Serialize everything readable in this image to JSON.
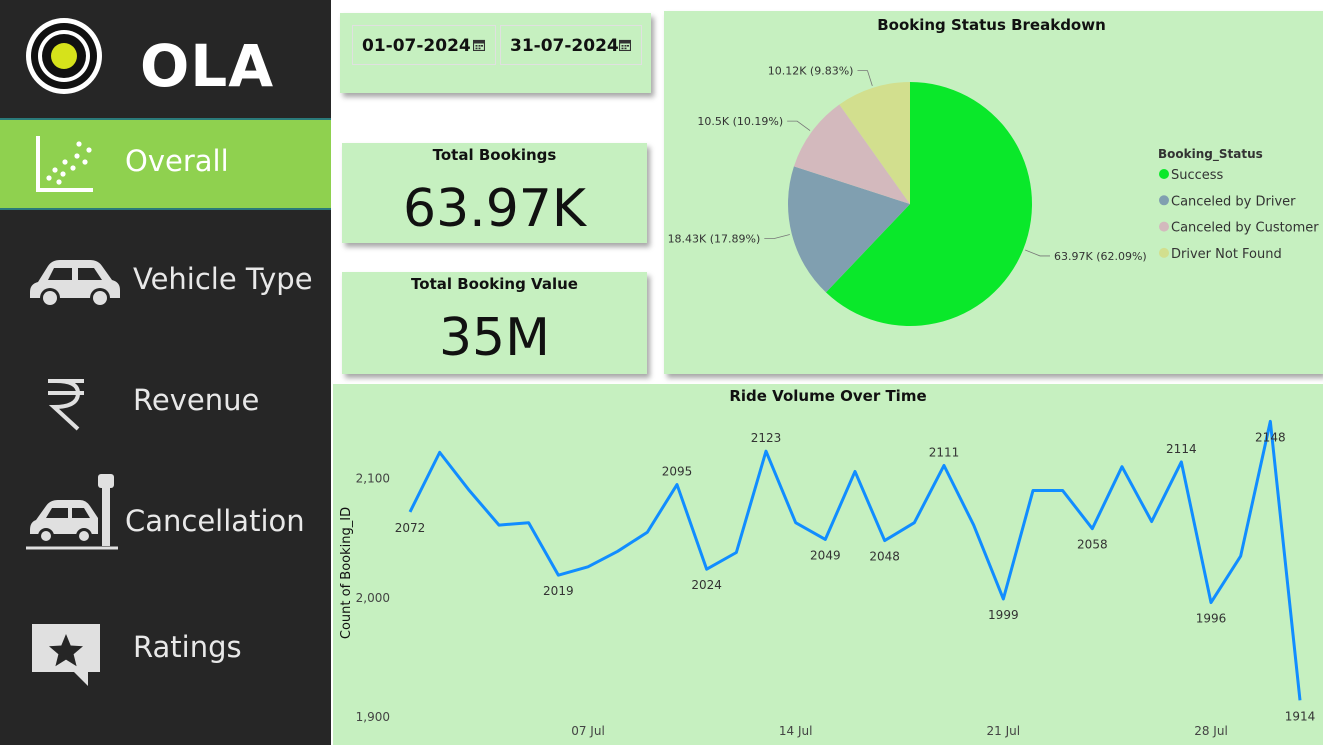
{
  "brand": {
    "name": "OLA"
  },
  "sidebar": {
    "items": [
      {
        "label": "Overall",
        "icon": "scatter-chart-icon",
        "active": true
      },
      {
        "label": "Vehicle Type",
        "icon": "car-icon",
        "active": false
      },
      {
        "label": "Revenue",
        "icon": "rupee-icon",
        "active": false
      },
      {
        "label": "Cancellation",
        "icon": "car-crash-icon",
        "active": false
      },
      {
        "label": "Ratings",
        "icon": "star-comment-icon",
        "active": false
      }
    ]
  },
  "filters": {
    "start_date": "01-07-2024",
    "end_date": "31-07-2024"
  },
  "kpis": {
    "total_bookings": {
      "title": "Total Bookings",
      "value": "63.97K"
    },
    "total_booking_value": {
      "title": "Total Booking Value",
      "value": "35M"
    }
  },
  "colors": {
    "sidebar_bg": "#262626",
    "active_nav": "#8fd14f",
    "card_bg": "#c6f0c0",
    "line": "#118DFF",
    "success": "#0ae82a",
    "canceled_driver": "#809fb0",
    "canceled_customer": "#d3b9bd",
    "driver_not_found": "#d2df8e"
  },
  "pie_chart": {
    "chart_data": {
      "type": "pie",
      "title": "Booking Status Breakdown",
      "legend_title": "Booking_Status",
      "legend_position": "right",
      "slices": [
        {
          "name": "Success",
          "value": 63970,
          "label": "63.97K (62.09%)",
          "color": "#0ae82a"
        },
        {
          "name": "Canceled by Driver",
          "value": 18430,
          "label": "18.43K (17.89%)",
          "color": "#809fb0"
        },
        {
          "name": "Canceled by Customer",
          "value": 10500,
          "label": "10.5K (10.19%)",
          "color": "#d3b9bd"
        },
        {
          "name": "Driver Not Found",
          "value": 10120,
          "label": "10.12K (9.83%)",
          "color": "#d2df8e"
        }
      ]
    }
  },
  "line_chart": {
    "chart_data": {
      "type": "line",
      "title": "Ride Volume Over Time",
      "ylabel": "Count of Booking_ID",
      "xlabel": "",
      "ylim": [
        1900,
        2150
      ],
      "y_ticks": [
        "1,900",
        "2,000",
        "2,100"
      ],
      "x_ticks": [
        "07 Jul",
        "14 Jul",
        "21 Jul",
        "28 Jul"
      ],
      "grid": false,
      "x": [
        "2024-07-01",
        "2024-07-02",
        "2024-07-03",
        "2024-07-04",
        "2024-07-05",
        "2024-07-06",
        "2024-07-07",
        "2024-07-08",
        "2024-07-09",
        "2024-07-10",
        "2024-07-11",
        "2024-07-12",
        "2024-07-13",
        "2024-07-14",
        "2024-07-15",
        "2024-07-16",
        "2024-07-17",
        "2024-07-18",
        "2024-07-19",
        "2024-07-20",
        "2024-07-21",
        "2024-07-22",
        "2024-07-23",
        "2024-07-24",
        "2024-07-25",
        "2024-07-26",
        "2024-07-27",
        "2024-07-28",
        "2024-07-29",
        "2024-07-30",
        "2024-07-31"
      ],
      "series": [
        {
          "values": [
            2072,
            2122,
            2090,
            2061,
            2063,
            2019,
            2026,
            2039,
            2055,
            2095,
            2024,
            2038,
            2123,
            2063,
            2049,
            2106,
            2048,
            2063,
            2111,
            2061,
            1999,
            2090,
            2090,
            2058,
            2110,
            2064,
            2114,
            1996,
            2035,
            2148,
            1914
          ]
        }
      ],
      "data_labels": [
        {
          "index": 0,
          "text": "2072",
          "pos": "below"
        },
        {
          "index": 5,
          "text": "2019",
          "pos": "below"
        },
        {
          "index": 9,
          "text": "2095",
          "pos": "above"
        },
        {
          "index": 10,
          "text": "2024",
          "pos": "below"
        },
        {
          "index": 12,
          "text": "2123",
          "pos": "above"
        },
        {
          "index": 14,
          "text": "2049",
          "pos": "below"
        },
        {
          "index": 16,
          "text": "2048",
          "pos": "below"
        },
        {
          "index": 18,
          "text": "2111",
          "pos": "above"
        },
        {
          "index": 20,
          "text": "1999",
          "pos": "below"
        },
        {
          "index": 23,
          "text": "2058",
          "pos": "below"
        },
        {
          "index": 26,
          "text": "2114",
          "pos": "above"
        },
        {
          "index": 27,
          "text": "1996",
          "pos": "below"
        },
        {
          "index": 29,
          "text": "2148",
          "pos": "below"
        },
        {
          "index": 30,
          "text": "1914",
          "pos": "below"
        }
      ]
    }
  }
}
